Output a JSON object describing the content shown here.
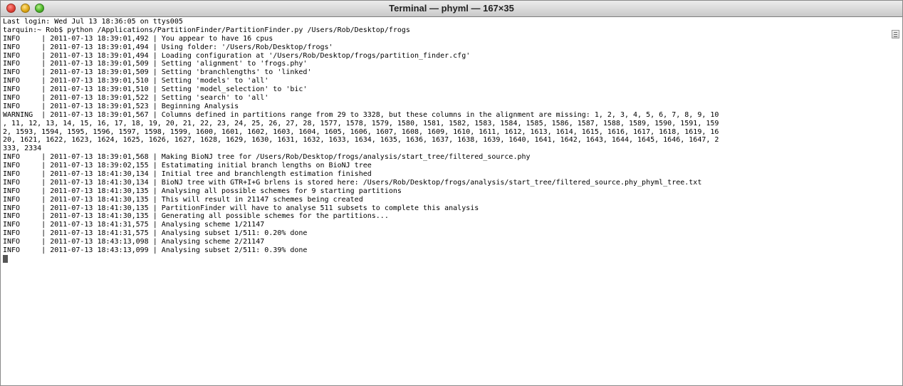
{
  "window": {
    "title": "Terminal — phyml — 167×35"
  },
  "terminal": {
    "lines": [
      "Last login: Wed Jul 13 18:36:05 on ttys005",
      "tarquin:~ Rob$ python /Applications/PartitionFinder/PartitionFinder.py /Users/Rob/Desktop/frogs",
      "INFO     | 2011-07-13 18:39:01,492 | You appear to have 16 cpus",
      "INFO     | 2011-07-13 18:39:01,494 | Using folder: '/Users/Rob/Desktop/frogs'",
      "INFO     | 2011-07-13 18:39:01,494 | Loading configuration at '/Users/Rob/Desktop/frogs/partition_finder.cfg'",
      "INFO     | 2011-07-13 18:39:01,509 | Setting 'alignment' to 'frogs.phy'",
      "INFO     | 2011-07-13 18:39:01,509 | Setting 'branchlengths' to 'linked'",
      "INFO     | 2011-07-13 18:39:01,510 | Setting 'models' to 'all'",
      "INFO     | 2011-07-13 18:39:01,510 | Setting 'model_selection' to 'bic'",
      "INFO     | 2011-07-13 18:39:01,522 | Setting 'search' to 'all'",
      "INFO     | 2011-07-13 18:39:01,523 | Beginning Analysis",
      "WARNING  | 2011-07-13 18:39:01,567 | Columns defined in partitions range from 29 to 3328, but these columns in the alignment are missing: 1, 2, 3, 4, 5, 6, 7, 8, 9, 10",
      ", 11, 12, 13, 14, 15, 16, 17, 18, 19, 20, 21, 22, 23, 24, 25, 26, 27, 28, 1577, 1578, 1579, 1580, 1581, 1582, 1583, 1584, 1585, 1586, 1587, 1588, 1589, 1590, 1591, 159",
      "2, 1593, 1594, 1595, 1596, 1597, 1598, 1599, 1600, 1601, 1602, 1603, 1604, 1605, 1606, 1607, 1608, 1609, 1610, 1611, 1612, 1613, 1614, 1615, 1616, 1617, 1618, 1619, 16",
      "20, 1621, 1622, 1623, 1624, 1625, 1626, 1627, 1628, 1629, 1630, 1631, 1632, 1633, 1634, 1635, 1636, 1637, 1638, 1639, 1640, 1641, 1642, 1643, 1644, 1645, 1646, 1647, 2",
      "333, 2334",
      "INFO     | 2011-07-13 18:39:01,568 | Making BioNJ tree for /Users/Rob/Desktop/frogs/analysis/start_tree/filtered_source.phy",
      "INFO     | 2011-07-13 18:39:02,155 | Estatimating initial branch lengths on BioNJ tree",
      "INFO     | 2011-07-13 18:41:30,134 | Initial tree and branchlength estimation finished",
      "INFO     | 2011-07-13 18:41:30,134 | BioNJ tree with GTR+I+G brlens is stored here: /Users/Rob/Desktop/frogs/analysis/start_tree/filtered_source.phy_phyml_tree.txt",
      "INFO     | 2011-07-13 18:41:30,135 | Analysing all possible schemes for 9 starting partitions",
      "INFO     | 2011-07-13 18:41:30,135 | This will result in 21147 schemes being created",
      "INFO     | 2011-07-13 18:41:30,135 | PartitionFinder will have to analyse 511 subsets to complete this analysis",
      "INFO     | 2011-07-13 18:41:30,135 | Generating all possible schemes for the partitions...",
      "INFO     | 2011-07-13 18:41:31,575 | Analysing scheme 1/21147",
      "INFO     | 2011-07-13 18:41:31,575 | Analysing subset 1/511: 0.20% done",
      "INFO     | 2011-07-13 18:43:13,098 | Analysing scheme 2/21147",
      "INFO     | 2011-07-13 18:43:13,099 | Analysing subset 2/511: 0.39% done"
    ]
  }
}
